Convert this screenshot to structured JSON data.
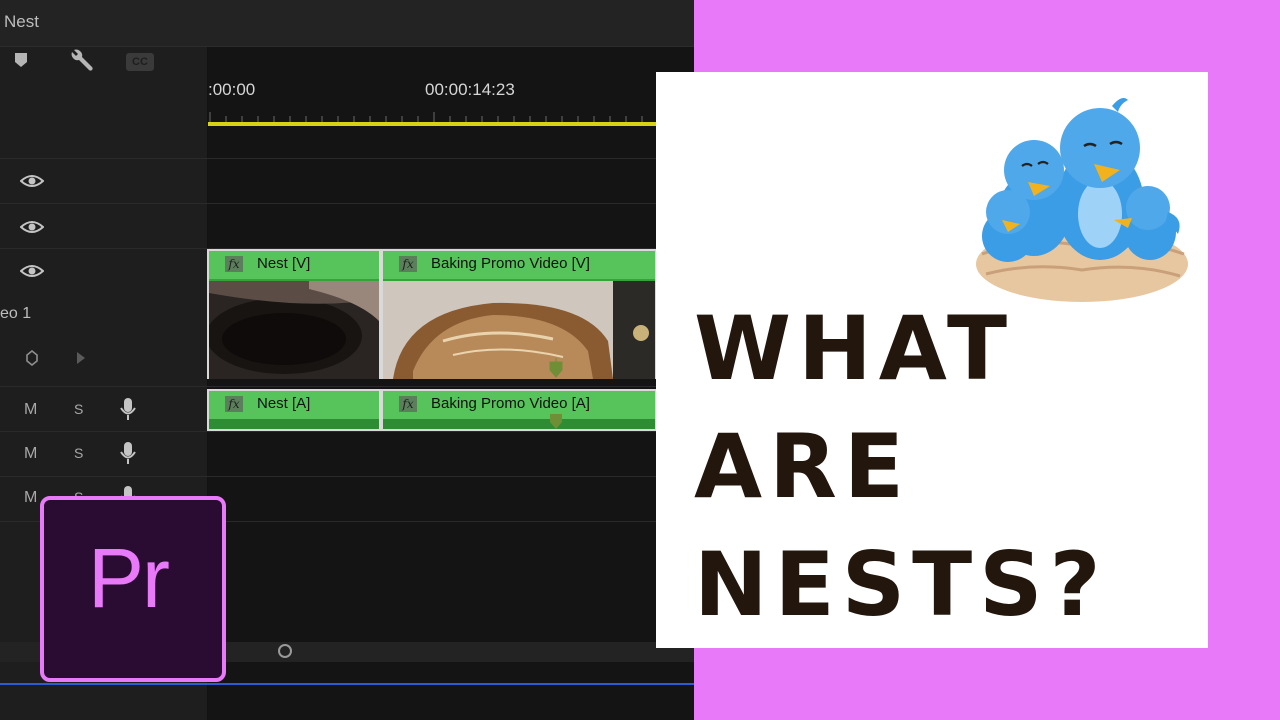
{
  "panel": {
    "title": "Nest"
  },
  "ruler": {
    "tick_left": ":00:00",
    "tick_mid": "00:00:14:23"
  },
  "tracks": {
    "video1_label": "eo 1",
    "audio_buttons": {
      "mute": "M",
      "solo": "S"
    }
  },
  "clips": {
    "video": [
      {
        "name": "Nest [V]",
        "fx": "fx"
      },
      {
        "name": "Baking Promo Video [V]",
        "fx": "fx"
      }
    ],
    "audio": [
      {
        "name": "Nest [A]",
        "fx": "fx"
      },
      {
        "name": "Baking Promo Video [A]",
        "fx": "fx"
      }
    ]
  },
  "logo": {
    "text": "Pr"
  },
  "card": {
    "line1": "WHAT",
    "line2": "ARE",
    "line3": "NESTS?"
  },
  "colors": {
    "accent": "#e879f9",
    "clip_green": "#56c45a",
    "playhead_bar": "#d8d214",
    "headline": "#23160c"
  }
}
